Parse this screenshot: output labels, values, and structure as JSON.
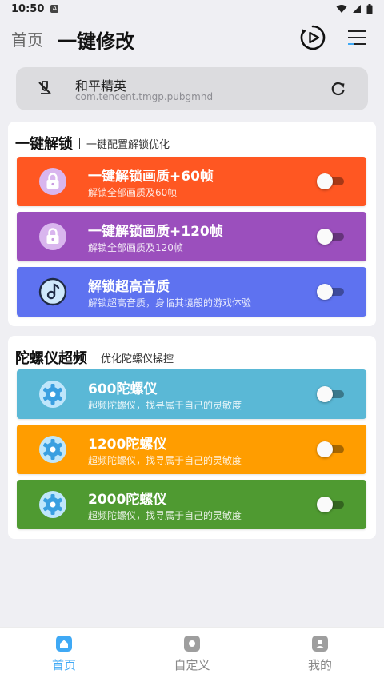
{
  "status": {
    "time": "10:50",
    "notif_icon": "A"
  },
  "header": {
    "back_label": "首页",
    "title": "一键修改",
    "icons": [
      "play-circle-icon",
      "menu-icon"
    ]
  },
  "app": {
    "name": "和平精英",
    "package": "com.tencent.tmgp.pubgmhd"
  },
  "sections": [
    {
      "title": "一键解锁",
      "subtitle": "一键配置解锁优化",
      "items": [
        {
          "title": "一键解锁画质+60帧",
          "desc": "解锁全部画质及60帧",
          "color": "#ff5722",
          "icon": "lock-icon",
          "enabled": false
        },
        {
          "title": "一键解锁画质+120帧",
          "desc": "解锁全部画质及120帧",
          "color": "#9b4fbd",
          "icon": "lock-icon",
          "enabled": false
        },
        {
          "title": "解锁超高音质",
          "desc": "解锁超高音质，身临其境般的游戏体验",
          "color": "#5e72f0",
          "icon": "music-icon",
          "enabled": false
        }
      ]
    },
    {
      "title": "陀螺仪超频",
      "subtitle": "优化陀螺仪操控",
      "items": [
        {
          "title": "600陀螺仪",
          "desc": "超频陀螺仪，找寻属于自己的灵敏度",
          "color": "#5ab8d6",
          "icon": "gear-icon",
          "enabled": false
        },
        {
          "title": "1200陀螺仪",
          "desc": "超频陀螺仪，找寻属于自己的灵敏度",
          "color": "#ff9d00",
          "icon": "gear-icon",
          "enabled": false
        },
        {
          "title": "2000陀螺仪",
          "desc": "超频陀螺仪，找寻属于自己的灵敏度",
          "color": "#4f9a31",
          "icon": "gear-icon",
          "enabled": false
        }
      ]
    }
  ],
  "bottom_nav": [
    {
      "label": "首页",
      "icon": "home-icon",
      "active": true
    },
    {
      "label": "自定义",
      "icon": "custom-icon",
      "active": false
    },
    {
      "label": "我的",
      "icon": "profile-icon",
      "active": false
    }
  ],
  "colors": {
    "accent": "#3fa9f5",
    "inactive": "#8a8a8a",
    "section_bg": "#ffffff",
    "page_bg": "#efeff3"
  }
}
